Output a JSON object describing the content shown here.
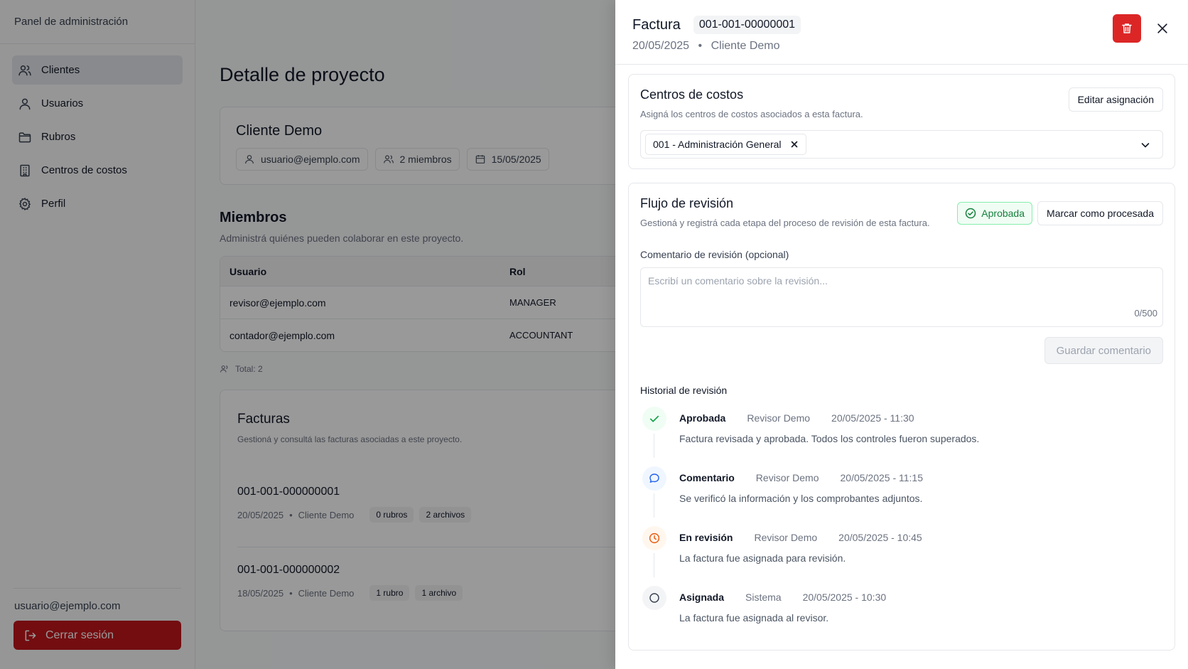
{
  "sidebar": {
    "title": "Panel de administración",
    "items": [
      {
        "label": "Clientes",
        "icon": "users-icon",
        "active": true
      },
      {
        "label": "Usuarios",
        "icon": "user-icon"
      },
      {
        "label": "Rubros",
        "icon": "folder-icon"
      },
      {
        "label": "Centros de costos",
        "icon": "building-icon"
      },
      {
        "label": "Perfil",
        "icon": "gear-icon"
      }
    ],
    "user_email": "usuario@ejemplo.com",
    "logout_label": "Cerrar sesión"
  },
  "main": {
    "title": "Detalle de proyecto",
    "client": {
      "name": "Cliente Demo",
      "email": "usuario@ejemplo.com",
      "members": "2 miembros",
      "date": "15/05/2025"
    },
    "members_section": {
      "title": "Miembros",
      "subtitle": "Administrá quiénes pueden colaborar en este proyecto.",
      "columns": [
        "Usuario",
        "Rol"
      ],
      "rows": [
        {
          "user": "revisor@ejemplo.com",
          "role": "MANAGER"
        },
        {
          "user": "contador@ejemplo.com",
          "role": "ACCOUNTANT"
        }
      ],
      "total": "Total: 2"
    },
    "invoices_section": {
      "title": "Facturas",
      "subtitle": "Gestioná y consultá las facturas asociadas a este proyecto.",
      "items": [
        {
          "number": "001-001-000000001",
          "date": "20/05/2025",
          "client": "Cliente Demo",
          "rubros": "0 rubros",
          "files": "2 archivos"
        },
        {
          "number": "001-001-000000002",
          "date": "18/05/2025",
          "client": "Cliente Demo",
          "rubros": "1 rubro",
          "files": "1 archivo"
        }
      ]
    }
  },
  "drawer": {
    "title": "Factura",
    "invoice_number": "001-001-00000001",
    "date": "20/05/2025",
    "separator": "•",
    "client": "Cliente Demo",
    "cost_centers": {
      "title": "Centros de costos",
      "subtitle": "Asigná los centros de costos asociados a esta factura.",
      "edit_label": "Editar asignación",
      "selected": "001 - Administración General"
    },
    "review": {
      "title": "Flujo de revisión",
      "subtitle": "Gestioná y registrá cada etapa del proceso de revisión de esta factura.",
      "status": "Aprobada",
      "mark_label": "Marcar como procesada",
      "comment_label": "Comentario de revisión (opcional)",
      "comment_placeholder": "Escribí un comentario sobre la revisión...",
      "counter": "0/500",
      "save_label": "Guardar comentario",
      "history_title": "Historial de revisión",
      "history": [
        {
          "status": "Aprobada",
          "by": "Revisor Demo",
          "time": "20/05/2025 - 11:30",
          "text": "Factura revisada y aprobada. Todos los controles fueron superados.",
          "icon": "check-icon",
          "color": "#16a34a"
        },
        {
          "status": "Comentario",
          "by": "Revisor Demo",
          "time": "20/05/2025 - 11:15",
          "text": "Se verificó la información y los comprobantes adjuntos.",
          "icon": "comment-icon",
          "color": "#2563eb"
        },
        {
          "status": "En revisión",
          "by": "Revisor Demo",
          "time": "20/05/2025 - 10:45",
          "text": "La factura fue asignada para revisión.",
          "icon": "clock-icon",
          "color": "#ea580c"
        },
        {
          "status": "Asignada",
          "by": "Sistema",
          "time": "20/05/2025 - 10:30",
          "text": "La factura fue asignada al revisor.",
          "icon": "circle-icon",
          "color": "#374151"
        }
      ]
    }
  },
  "colors": {
    "danger": "#dc2626",
    "logout": "#c0161c",
    "success": "#16a34a"
  }
}
